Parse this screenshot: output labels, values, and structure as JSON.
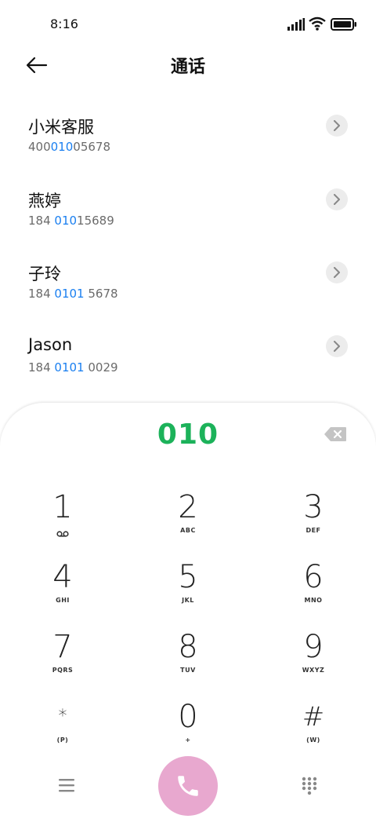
{
  "status_bar": {
    "time": "8:16"
  },
  "header": {
    "title": "通话"
  },
  "contacts": [
    {
      "name": "小米客服",
      "number_pre": "400",
      "number_match": "010",
      "number_post": "05678"
    },
    {
      "name": "燕婷",
      "number_pre": "184 ",
      "number_match": "010",
      "number_post": "15689"
    },
    {
      "name": "子玲",
      "number_pre": "184 ",
      "number_match": "0101",
      "number_post": " 5678"
    },
    {
      "name": "Jason",
      "number_pre": "184 ",
      "number_match": "0101",
      "number_post": " 0029"
    }
  ],
  "dialpad": {
    "input": "010",
    "keys": [
      {
        "digit": "1",
        "letters": ""
      },
      {
        "digit": "2",
        "letters": "ABC"
      },
      {
        "digit": "3",
        "letters": "DEF"
      },
      {
        "digit": "4",
        "letters": "GHI"
      },
      {
        "digit": "5",
        "letters": "JKL"
      },
      {
        "digit": "6",
        "letters": "MNO"
      },
      {
        "digit": "7",
        "letters": "PQRS"
      },
      {
        "digit": "8",
        "letters": "TUV"
      },
      {
        "digit": "9",
        "letters": "WXYZ"
      },
      {
        "digit": "*",
        "letters": "(P)"
      },
      {
        "digit": "0",
        "letters": "+"
      },
      {
        "digit": "#",
        "letters": "(W)"
      }
    ]
  },
  "colors": {
    "accent_green": "#1cb25a",
    "highlight_blue": "#1a7ff0",
    "call_button": "#e8a8cf"
  },
  "icons": {
    "back": "arrow-left-icon",
    "detail": "chevron-right-icon",
    "backspace": "backspace-icon",
    "voicemail": "voicemail-icon",
    "menu": "menu-icon",
    "call": "phone-icon",
    "keypad": "keypad-icon"
  }
}
